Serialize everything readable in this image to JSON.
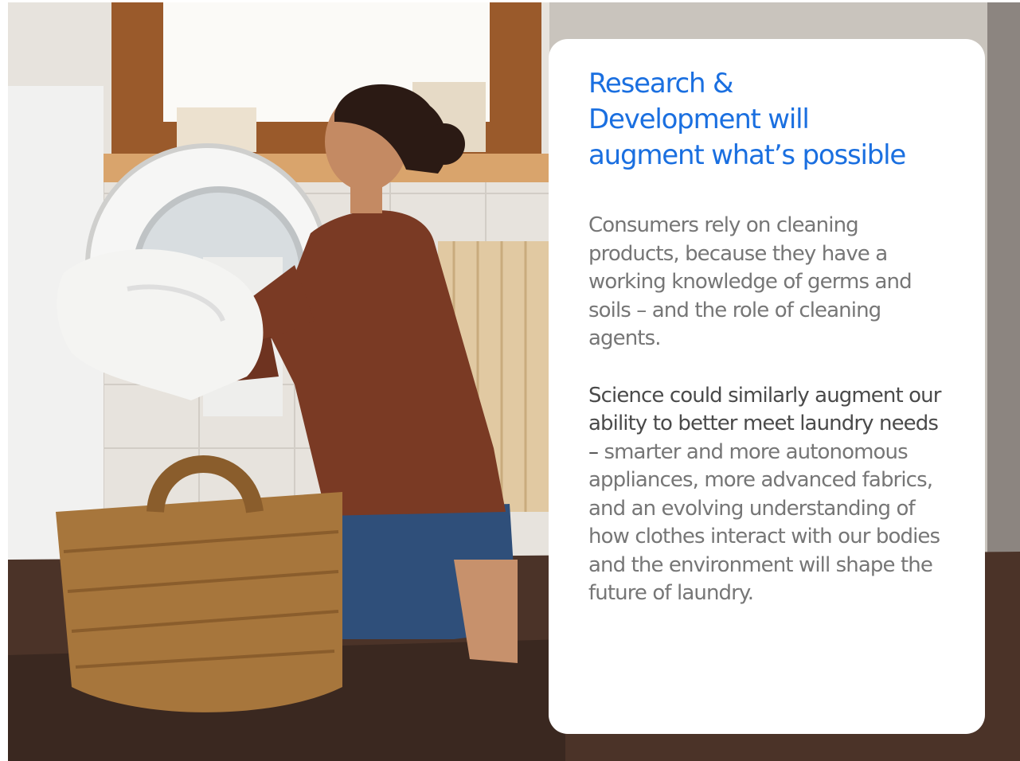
{
  "photo": {
    "subject": "woman-loading-washing-machine-photo",
    "colors": {
      "wall": "#e9e6e1",
      "window_frame": "#9a5a2b",
      "shirt": "#7a3a24",
      "jeans": "#2f4f7a",
      "basket": "#a7763c",
      "floor": "#3e2a22",
      "towel": "#f4f4f2"
    }
  },
  "card": {
    "title": "Research & Development will augment what’s possible",
    "paragraph1": "Consumers rely on cleaning products, because they have a working knowledge of germs and soils – and the role of cleaning agents.",
    "paragraph2_lead": "Science could similarly augment our ability to better meet laundry needs –",
    "paragraph2_rest": " smarter and more autonomous appliances, more advanced fabrics, and an evolving understanding of how clothes interact with our bodies and the environment will shape the future of laundry.",
    "colors": {
      "title": "#1a6fe0",
      "body": "#767676",
      "lead": "#4a4a4a",
      "background": "#ffffff"
    }
  }
}
